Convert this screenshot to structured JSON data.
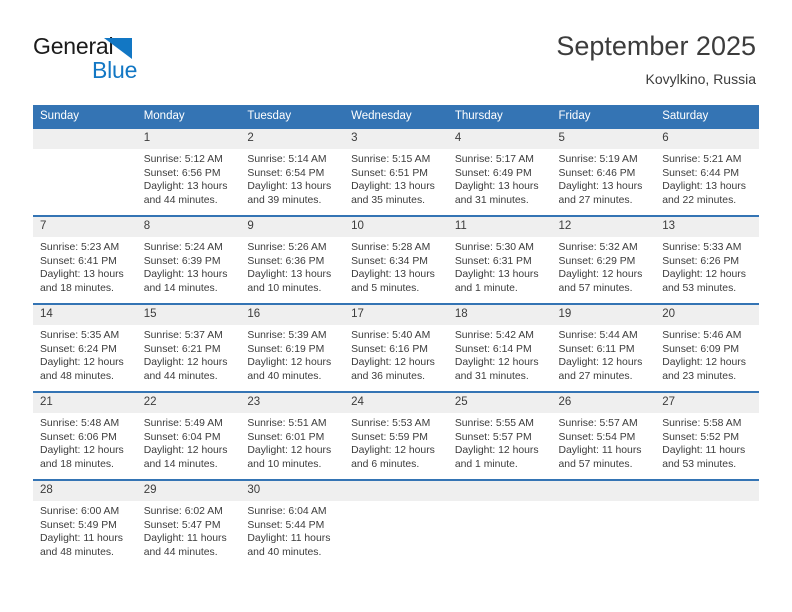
{
  "brand": {
    "name_line1": "General",
    "name_line2": "Blue",
    "logo_icon": "triangle-mark",
    "accent_color": "#1277c4"
  },
  "header": {
    "title": "September 2025",
    "subtitle": "Kovylkino, Russia"
  },
  "theme": {
    "header_blue": "#3474b4",
    "daynum_bg": "#efefef",
    "text": "#3c3c3c"
  },
  "calendar": {
    "weekday_headers": [
      "Sunday",
      "Monday",
      "Tuesday",
      "Wednesday",
      "Thursday",
      "Friday",
      "Saturday"
    ],
    "weeks": [
      [
        {
          "day": "",
          "sunrise": "",
          "sunset": "",
          "daylight": "",
          "empty": true
        },
        {
          "day": "1",
          "sunrise": "Sunrise: 5:12 AM",
          "sunset": "Sunset: 6:56 PM",
          "daylight": "Daylight: 13 hours and 44 minutes."
        },
        {
          "day": "2",
          "sunrise": "Sunrise: 5:14 AM",
          "sunset": "Sunset: 6:54 PM",
          "daylight": "Daylight: 13 hours and 39 minutes."
        },
        {
          "day": "3",
          "sunrise": "Sunrise: 5:15 AM",
          "sunset": "Sunset: 6:51 PM",
          "daylight": "Daylight: 13 hours and 35 minutes."
        },
        {
          "day": "4",
          "sunrise": "Sunrise: 5:17 AM",
          "sunset": "Sunset: 6:49 PM",
          "daylight": "Daylight: 13 hours and 31 minutes."
        },
        {
          "day": "5",
          "sunrise": "Sunrise: 5:19 AM",
          "sunset": "Sunset: 6:46 PM",
          "daylight": "Daylight: 13 hours and 27 minutes."
        },
        {
          "day": "6",
          "sunrise": "Sunrise: 5:21 AM",
          "sunset": "Sunset: 6:44 PM",
          "daylight": "Daylight: 13 hours and 22 minutes."
        }
      ],
      [
        {
          "day": "7",
          "sunrise": "Sunrise: 5:23 AM",
          "sunset": "Sunset: 6:41 PM",
          "daylight": "Daylight: 13 hours and 18 minutes."
        },
        {
          "day": "8",
          "sunrise": "Sunrise: 5:24 AM",
          "sunset": "Sunset: 6:39 PM",
          "daylight": "Daylight: 13 hours and 14 minutes."
        },
        {
          "day": "9",
          "sunrise": "Sunrise: 5:26 AM",
          "sunset": "Sunset: 6:36 PM",
          "daylight": "Daylight: 13 hours and 10 minutes."
        },
        {
          "day": "10",
          "sunrise": "Sunrise: 5:28 AM",
          "sunset": "Sunset: 6:34 PM",
          "daylight": "Daylight: 13 hours and 5 minutes."
        },
        {
          "day": "11",
          "sunrise": "Sunrise: 5:30 AM",
          "sunset": "Sunset: 6:31 PM",
          "daylight": "Daylight: 13 hours and 1 minute."
        },
        {
          "day": "12",
          "sunrise": "Sunrise: 5:32 AM",
          "sunset": "Sunset: 6:29 PM",
          "daylight": "Daylight: 12 hours and 57 minutes."
        },
        {
          "day": "13",
          "sunrise": "Sunrise: 5:33 AM",
          "sunset": "Sunset: 6:26 PM",
          "daylight": "Daylight: 12 hours and 53 minutes."
        }
      ],
      [
        {
          "day": "14",
          "sunrise": "Sunrise: 5:35 AM",
          "sunset": "Sunset: 6:24 PM",
          "daylight": "Daylight: 12 hours and 48 minutes."
        },
        {
          "day": "15",
          "sunrise": "Sunrise: 5:37 AM",
          "sunset": "Sunset: 6:21 PM",
          "daylight": "Daylight: 12 hours and 44 minutes."
        },
        {
          "day": "16",
          "sunrise": "Sunrise: 5:39 AM",
          "sunset": "Sunset: 6:19 PM",
          "daylight": "Daylight: 12 hours and 40 minutes."
        },
        {
          "day": "17",
          "sunrise": "Sunrise: 5:40 AM",
          "sunset": "Sunset: 6:16 PM",
          "daylight": "Daylight: 12 hours and 36 minutes."
        },
        {
          "day": "18",
          "sunrise": "Sunrise: 5:42 AM",
          "sunset": "Sunset: 6:14 PM",
          "daylight": "Daylight: 12 hours and 31 minutes."
        },
        {
          "day": "19",
          "sunrise": "Sunrise: 5:44 AM",
          "sunset": "Sunset: 6:11 PM",
          "daylight": "Daylight: 12 hours and 27 minutes."
        },
        {
          "day": "20",
          "sunrise": "Sunrise: 5:46 AM",
          "sunset": "Sunset: 6:09 PM",
          "daylight": "Daylight: 12 hours and 23 minutes."
        }
      ],
      [
        {
          "day": "21",
          "sunrise": "Sunrise: 5:48 AM",
          "sunset": "Sunset: 6:06 PM",
          "daylight": "Daylight: 12 hours and 18 minutes."
        },
        {
          "day": "22",
          "sunrise": "Sunrise: 5:49 AM",
          "sunset": "Sunset: 6:04 PM",
          "daylight": "Daylight: 12 hours and 14 minutes."
        },
        {
          "day": "23",
          "sunrise": "Sunrise: 5:51 AM",
          "sunset": "Sunset: 6:01 PM",
          "daylight": "Daylight: 12 hours and 10 minutes."
        },
        {
          "day": "24",
          "sunrise": "Sunrise: 5:53 AM",
          "sunset": "Sunset: 5:59 PM",
          "daylight": "Daylight: 12 hours and 6 minutes."
        },
        {
          "day": "25",
          "sunrise": "Sunrise: 5:55 AM",
          "sunset": "Sunset: 5:57 PM",
          "daylight": "Daylight: 12 hours and 1 minute."
        },
        {
          "day": "26",
          "sunrise": "Sunrise: 5:57 AM",
          "sunset": "Sunset: 5:54 PM",
          "daylight": "Daylight: 11 hours and 57 minutes."
        },
        {
          "day": "27",
          "sunrise": "Sunrise: 5:58 AM",
          "sunset": "Sunset: 5:52 PM",
          "daylight": "Daylight: 11 hours and 53 minutes."
        }
      ],
      [
        {
          "day": "28",
          "sunrise": "Sunrise: 6:00 AM",
          "sunset": "Sunset: 5:49 PM",
          "daylight": "Daylight: 11 hours and 48 minutes."
        },
        {
          "day": "29",
          "sunrise": "Sunrise: 6:02 AM",
          "sunset": "Sunset: 5:47 PM",
          "daylight": "Daylight: 11 hours and 44 minutes."
        },
        {
          "day": "30",
          "sunrise": "Sunrise: 6:04 AM",
          "sunset": "Sunset: 5:44 PM",
          "daylight": "Daylight: 11 hours and 40 minutes."
        },
        {
          "day": "",
          "sunrise": "",
          "sunset": "",
          "daylight": "",
          "empty": true
        },
        {
          "day": "",
          "sunrise": "",
          "sunset": "",
          "daylight": "",
          "empty": true
        },
        {
          "day": "",
          "sunrise": "",
          "sunset": "",
          "daylight": "",
          "empty": true
        },
        {
          "day": "",
          "sunrise": "",
          "sunset": "",
          "daylight": "",
          "empty": true
        }
      ]
    ]
  }
}
